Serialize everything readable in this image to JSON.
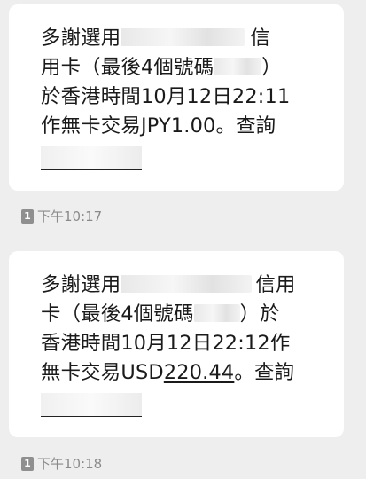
{
  "messages": [
    {
      "lines": {
        "l1_prefix": "多謝選用",
        "l1_suffix": "信",
        "l2_prefix": "用卡（最後4個號碼",
        "l2_suffix": "）",
        "l3": "於香港時間10月12日22:11",
        "l4": "作無卡交易JPY1.00。查詢"
      },
      "sim": "1",
      "time": "下午10:17"
    },
    {
      "lines": {
        "l1_prefix": "多謝選用",
        "l1_suffix": "信用",
        "l2_prefix": "卡（最後4個號碼",
        "l2_suffix": "）於",
        "l3": "香港時間10月12日22:12作",
        "l4_prefix": "無卡交易USD",
        "l4_amount": "220.44",
        "l4_suffix": "。查詢"
      },
      "sim": "1",
      "time": "下午10:18"
    }
  ]
}
